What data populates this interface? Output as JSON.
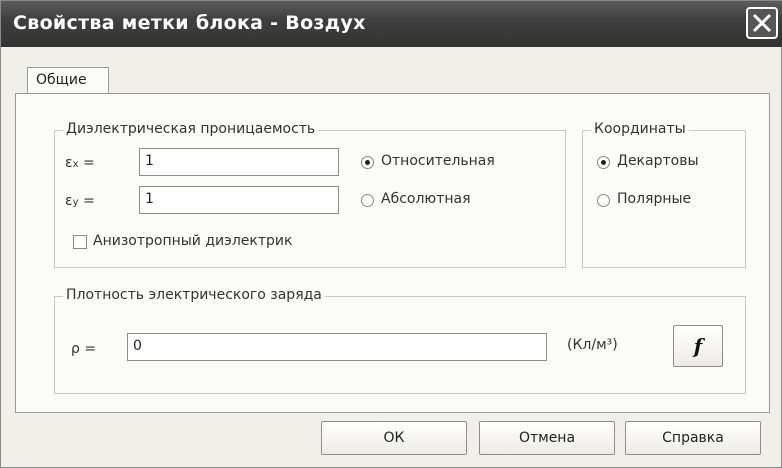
{
  "window": {
    "title": "Свойства метки блока - Воздух"
  },
  "tabs": [
    {
      "label": "Общие"
    }
  ],
  "dielectric": {
    "legend": "Диэлектрическая проницаемость",
    "ex_symbol": "ε",
    "ex_sub": "x",
    "ex_eq": "=",
    "ex_value": "1",
    "ey_symbol": "ε",
    "ey_sub": "y",
    "ey_eq": "=",
    "ey_value": "1",
    "relative_label": "Относительная",
    "absolute_label": "Абсолютная",
    "selected": "relative",
    "anisotropic_label": "Анизотропный диэлектрик",
    "anisotropic_checked": false
  },
  "coordinates": {
    "legend": "Координаты",
    "cartesian_label": "Декартовы",
    "polar_label": "Полярные",
    "selected": "cartesian"
  },
  "charge": {
    "legend": "Плотность электрического заряда",
    "rho_label": "ρ =",
    "value": "0",
    "unit": "(Кл/м³)",
    "function_button": "f"
  },
  "buttons": {
    "ok": "ОК",
    "cancel": "Отмена",
    "help": "Справка"
  }
}
